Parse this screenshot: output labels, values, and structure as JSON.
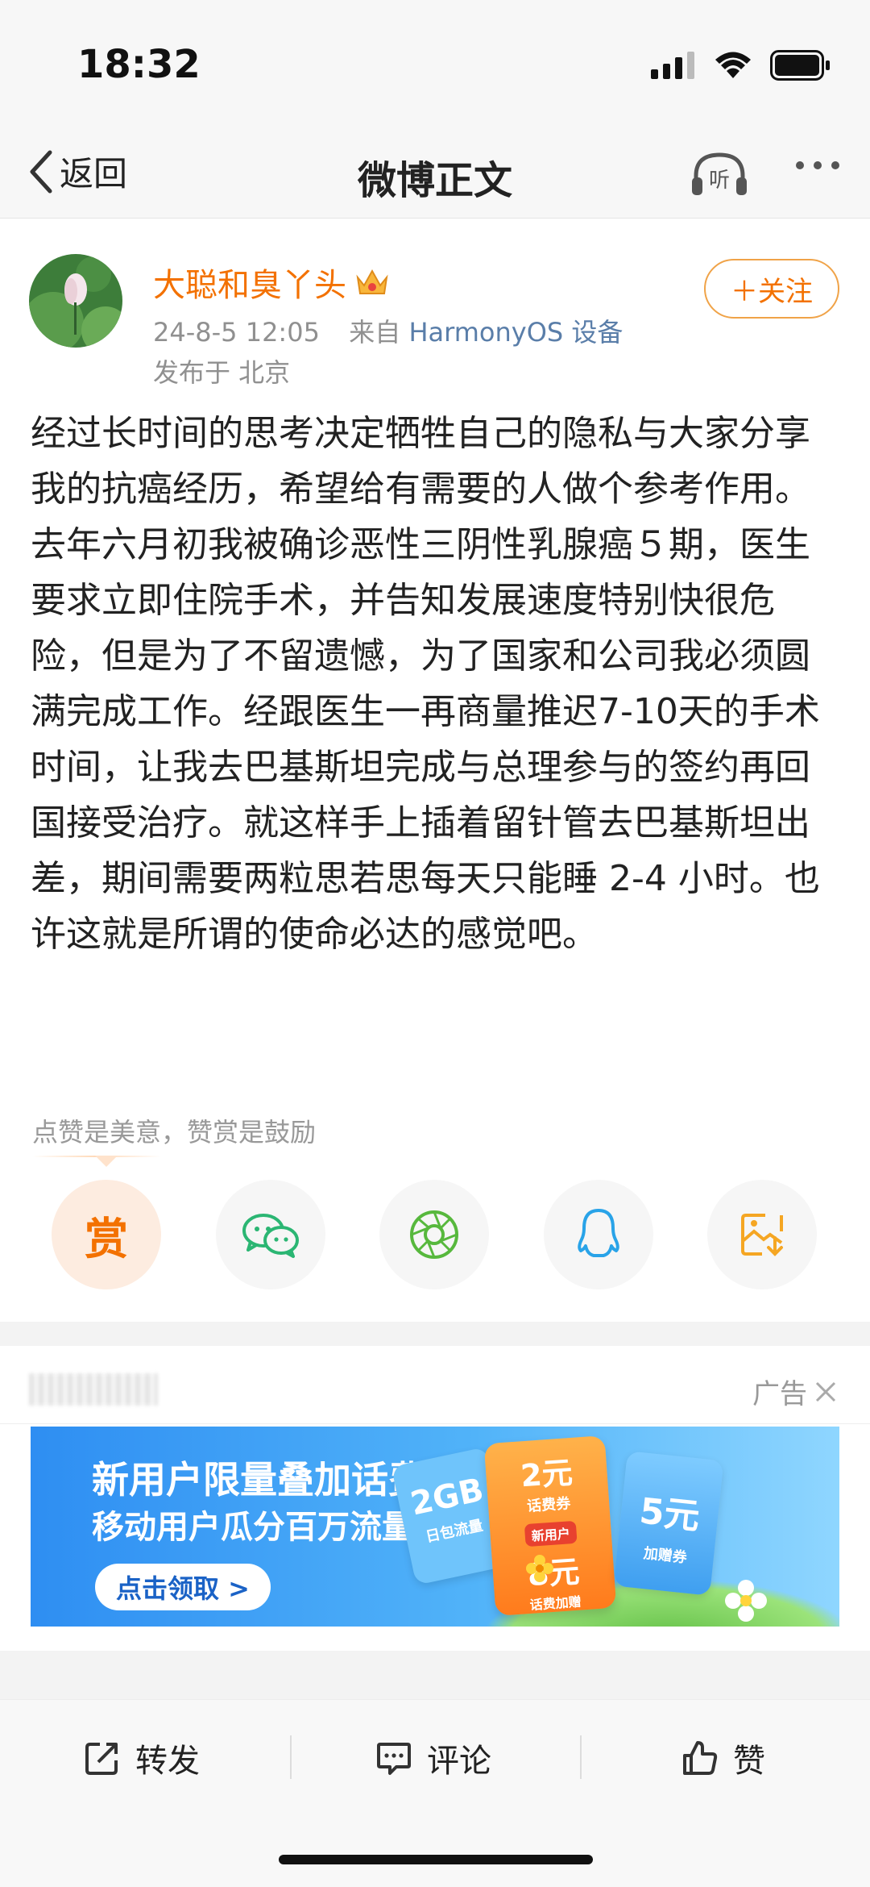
{
  "status": {
    "time": "18:32"
  },
  "nav": {
    "back_label": "返回",
    "title": "微博正文",
    "listen_label": "听"
  },
  "post": {
    "author": "大聪和臭丫头",
    "date": "24-8-5 12:05",
    "source_prefix": "来自",
    "source_device": "HarmonyOS 设备",
    "location": "发布于 北京",
    "follow_label": "＋关注",
    "body": "经过长时间的思考决定牺牲自己的隐私与大家分享我的抗癌经历，希望给有需要的人做个参考作用。\n去年六月初我被确诊恶性三阴性乳腺癌５期，医生要求立即住院手术，并告知发展速度特别快很危险，但是为了不留遗憾，为了国家和公司我必须圆满完成工作。经跟医生一再商量推迟7-10天的手术时间，让我去巴基斯坦完成与总理参与的签约再回国接受治疗。就这样手上插着留针管去巴基斯坦出差，期间需要两粒思若思每天只能睡 2-4 小时。也许这就是所谓的使命必达的感觉吧。",
    "reward_hint": "点赞是美意，赞赏是鼓励",
    "reward_char": "赏"
  },
  "share_icons": [
    "reward-icon",
    "wechat-icon",
    "moments-icon",
    "qq-icon",
    "save-image-icon"
  ],
  "ad": {
    "label": "广告",
    "headline": "新用户限量叠加话费福利",
    "subline": "移动用户瓜分百万流量",
    "cta": "点击领取 >",
    "ticket_2gb": "2GB",
    "ticket_2gb_sub": "日包流量",
    "ticket_2yuan": "2元",
    "ticket_2yuan_sub": "话费券",
    "ticket_new_user": "新用户",
    "ticket_8yuan": "8元",
    "ticket_8yuan_sub": "话费加赠",
    "ticket_5yuan": "5元",
    "ticket_5yuan_sub": "加赠券",
    "colors": {
      "banner": "#2e8ef2",
      "orange": "#ff8a1f"
    }
  },
  "bottom_bar": {
    "repost": "转发",
    "comment": "评论",
    "like": "赞"
  },
  "colors": {
    "accent": "#f37100",
    "link": "#5a7ea9"
  }
}
